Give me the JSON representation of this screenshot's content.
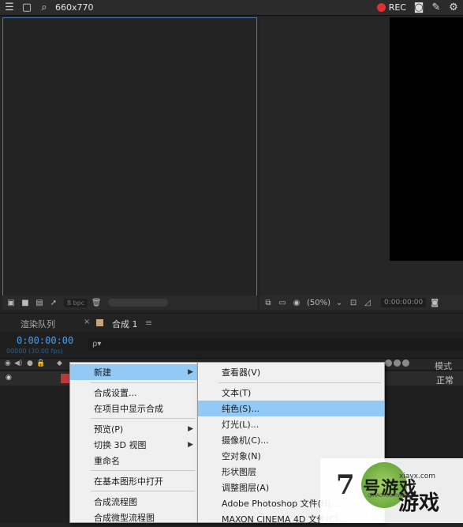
{
  "topbar": {
    "title": "660x770",
    "rec_label": "REC",
    "icons": [
      "menu-icon",
      "window-icon",
      "search-icon",
      "camera-icon",
      "pen-icon",
      "settings-icon"
    ]
  },
  "project_panel": {
    "bpc_label": "8 bpc"
  },
  "viewer_panel": {
    "zoom_label": "(50%)",
    "timecode": "0:00:00:00"
  },
  "tabs": {
    "render_queue": "渲染队列",
    "close_symbol": "×",
    "comp_name": "合成 1",
    "menu_symbol": "≡"
  },
  "timeline": {
    "timecode": "0:00:00:00",
    "fps": "00000 (30.00 fps)",
    "search_glyph": "ρ▾",
    "mode_label": "模式",
    "normal_label": "正常"
  },
  "context_menu": {
    "items": [
      "新建",
      "合成设置...",
      "在项目中显示合成",
      "预览(P)",
      "切换 3D 视图",
      "重命名",
      "在基本图形中打开",
      "合成流程图",
      "合成微型流程图"
    ]
  },
  "submenu": {
    "items": [
      "查看器(V)",
      "文本(T)",
      "纯色(S)...",
      "灯光(L)...",
      "摄像机(C)...",
      "空对象(N)",
      "形状图层",
      "调整图层(A)",
      "Adobe Photoshop 文件(H)...",
      "MAXON CINEMA 4D 文件(C)..."
    ]
  },
  "watermark": {
    "url": "xiayx.com",
    "glyph": "7",
    "text1": "号游戏",
    "text2": "游戏",
    "small": "QIHAOYOUXIWANG"
  },
  "colors": {
    "accent_blue": "#4a9fe6",
    "menu_highlight": "#91c9f7",
    "rec_red": "#e0322f",
    "layer_red": "#b83a3a"
  }
}
